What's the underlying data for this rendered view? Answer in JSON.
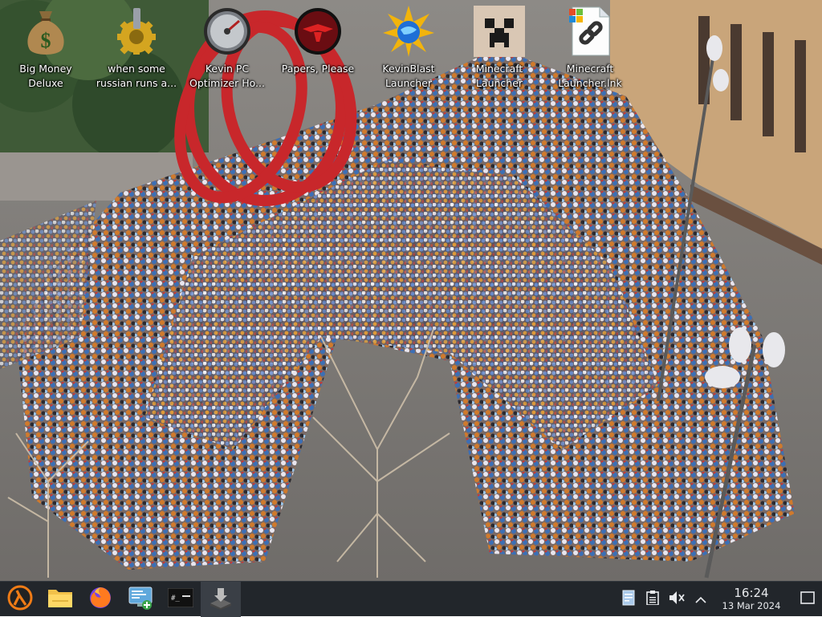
{
  "desktop": {
    "icons": [
      {
        "label_line1": "Big Money",
        "label_line2": "Deluxe",
        "icon": "money-bag-icon"
      },
      {
        "label_line1": "when some",
        "label_line2": "russian runs a...",
        "icon": "gear-icon"
      },
      {
        "label_line1": "Kevin PC",
        "label_line2": "Optimizer Ho...",
        "icon": "gauge-icon"
      },
      {
        "label_line1": "Papers, Please",
        "label_line2": "",
        "icon": "eagle-emblem-icon"
      },
      {
        "label_line1": "KevinBlast",
        "label_line2": "Launcher",
        "icon": "starburst-globe-icon"
      },
      {
        "label_line1": "Minecraft",
        "label_line2": "Launcher",
        "icon": "creeper-icon"
      },
      {
        "label_line1": "Minecraft",
        "label_line2": "Launcher.lnk",
        "icon": "shortcut-link-icon"
      }
    ]
  },
  "taskbar": {
    "apps": [
      {
        "name": "Start menu",
        "icon": "lambda-start-icon"
      },
      {
        "name": "File manager",
        "icon": "folder-icon"
      },
      {
        "name": "Firefox",
        "icon": "firefox-icon"
      },
      {
        "name": "System settings",
        "icon": "settings-monitor-icon"
      },
      {
        "name": "Terminal",
        "icon": "terminal-icon"
      },
      {
        "name": "Installer",
        "icon": "installer-icon"
      }
    ],
    "tray": {
      "icons": [
        "notes-icon",
        "clipboard-icon",
        "volume-muted-icon",
        "chevron-up-icon"
      ],
      "time": "16:24",
      "date": "13 Mar 2024"
    }
  },
  "colors": {
    "taskbar_bg": "#22262b",
    "sculpture_red": "#c8272b",
    "building": "#c9a57a"
  }
}
